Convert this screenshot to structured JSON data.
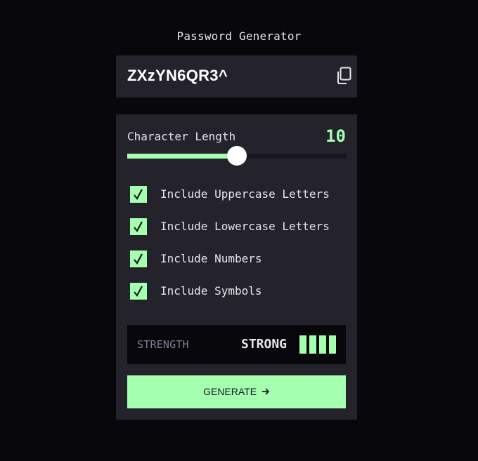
{
  "app": {
    "title": "Password Generator"
  },
  "password": {
    "value": "ZXzYN6QR3^",
    "copy_icon": "copy-icon"
  },
  "length": {
    "label": "Character Length",
    "value": "10",
    "min": 0,
    "max": 20,
    "current": 10
  },
  "options": [
    {
      "label": "Include Uppercase Letters",
      "checked": true
    },
    {
      "label": "Include Lowercase Letters",
      "checked": true
    },
    {
      "label": "Include Numbers",
      "checked": true
    },
    {
      "label": "Include Symbols",
      "checked": true
    }
  ],
  "strength": {
    "label": "STRENGTH",
    "value": "STRONG",
    "bars_filled": 4,
    "bars_total": 4
  },
  "generate": {
    "label": "GENERATE",
    "icon": "arrow-right-icon"
  },
  "colors": {
    "background": "#08070b",
    "panel": "#24232c",
    "accent": "#a4ffaf",
    "text": "#e6e5ea",
    "muted": "#817d92"
  }
}
